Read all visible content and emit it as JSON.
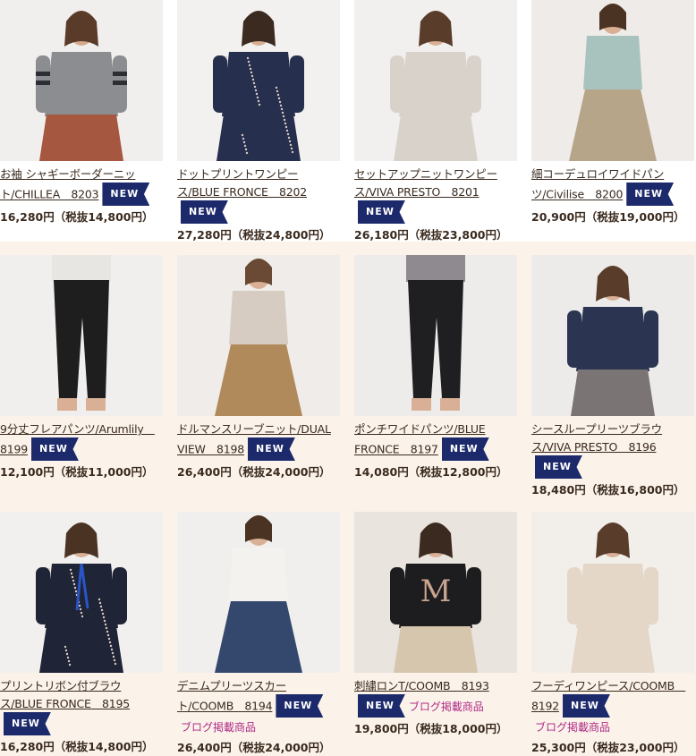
{
  "colors": {
    "badge_bg": "#1c2a6b",
    "blog_text": "#b02a86",
    "page_bg": "#fbf3ea"
  },
  "badge_label": "NEW",
  "blog_label": "ブログ掲載商品",
  "products": [
    {
      "name_line1": "お袖 シャギーボーダーニッ",
      "name_line2": "ト/CHILLEA　8203",
      "price": "16,280円（税抜14,800円）",
      "is_new": true,
      "blog": false
    },
    {
      "name_line1": "ドットプリントワンピー",
      "name_line2": "ス/BLUE FRONCE　8202",
      "price": "27,280円（税抜24,800円）",
      "is_new": true,
      "blog": false
    },
    {
      "name_line1": "セットアップニットワンピー",
      "name_line2": "ス/VIVA PRESTO　8201",
      "price": "26,180円（税抜23,800円）",
      "is_new": true,
      "blog": false
    },
    {
      "name_line1": "細コーデュロイワイドパン",
      "name_line2": "ツ/Civilise　8200",
      "price": "20,900円（税抜19,000円）",
      "is_new": true,
      "blog": false
    },
    {
      "name_line1": "9分丈フレアパンツ/Arumlily　",
      "name_line2": "8199",
      "price": "12,100円（税抜11,000円）",
      "is_new": true,
      "blog": false
    },
    {
      "name_line1": "ドルマンスリーブニット/DUAL",
      "name_line2": "VIEW　8198",
      "price": "26,400円（税抜24,000円）",
      "is_new": true,
      "blog": false
    },
    {
      "name_line1": "ポンチワイドパンツ/BLUE",
      "name_line2": "FRONCE　8197",
      "price": "14,080円（税抜12,800円）",
      "is_new": true,
      "blog": false
    },
    {
      "name_line1": "シースループリーツブラウ",
      "name_line2": "ス/VIVA PRESTO　8196",
      "price": "18,480円（税抜16,800円）",
      "is_new": true,
      "blog": false
    },
    {
      "name_line1": "プリントリボン付ブラウ",
      "name_line2": "ス/BLUE FRONCE　8195",
      "price": "16,280円（税抜14,800円）",
      "is_new": true,
      "blog": false
    },
    {
      "name_line1": "デニムプリーツスカー",
      "name_line2": "ト/COOMB　8194",
      "price": "26,400円（税抜24,000円）",
      "is_new": true,
      "blog": true
    },
    {
      "name_line1": "刺繍ロンT/COOMB　8193",
      "name_line2": "",
      "price": "19,800円（税抜18,000円）",
      "is_new": true,
      "blog": true
    },
    {
      "name_line1": "フーディワンピース/COOMB　",
      "name_line2": "8192",
      "price": "25,300円（税抜23,000円）",
      "is_new": true,
      "blog": true
    }
  ]
}
